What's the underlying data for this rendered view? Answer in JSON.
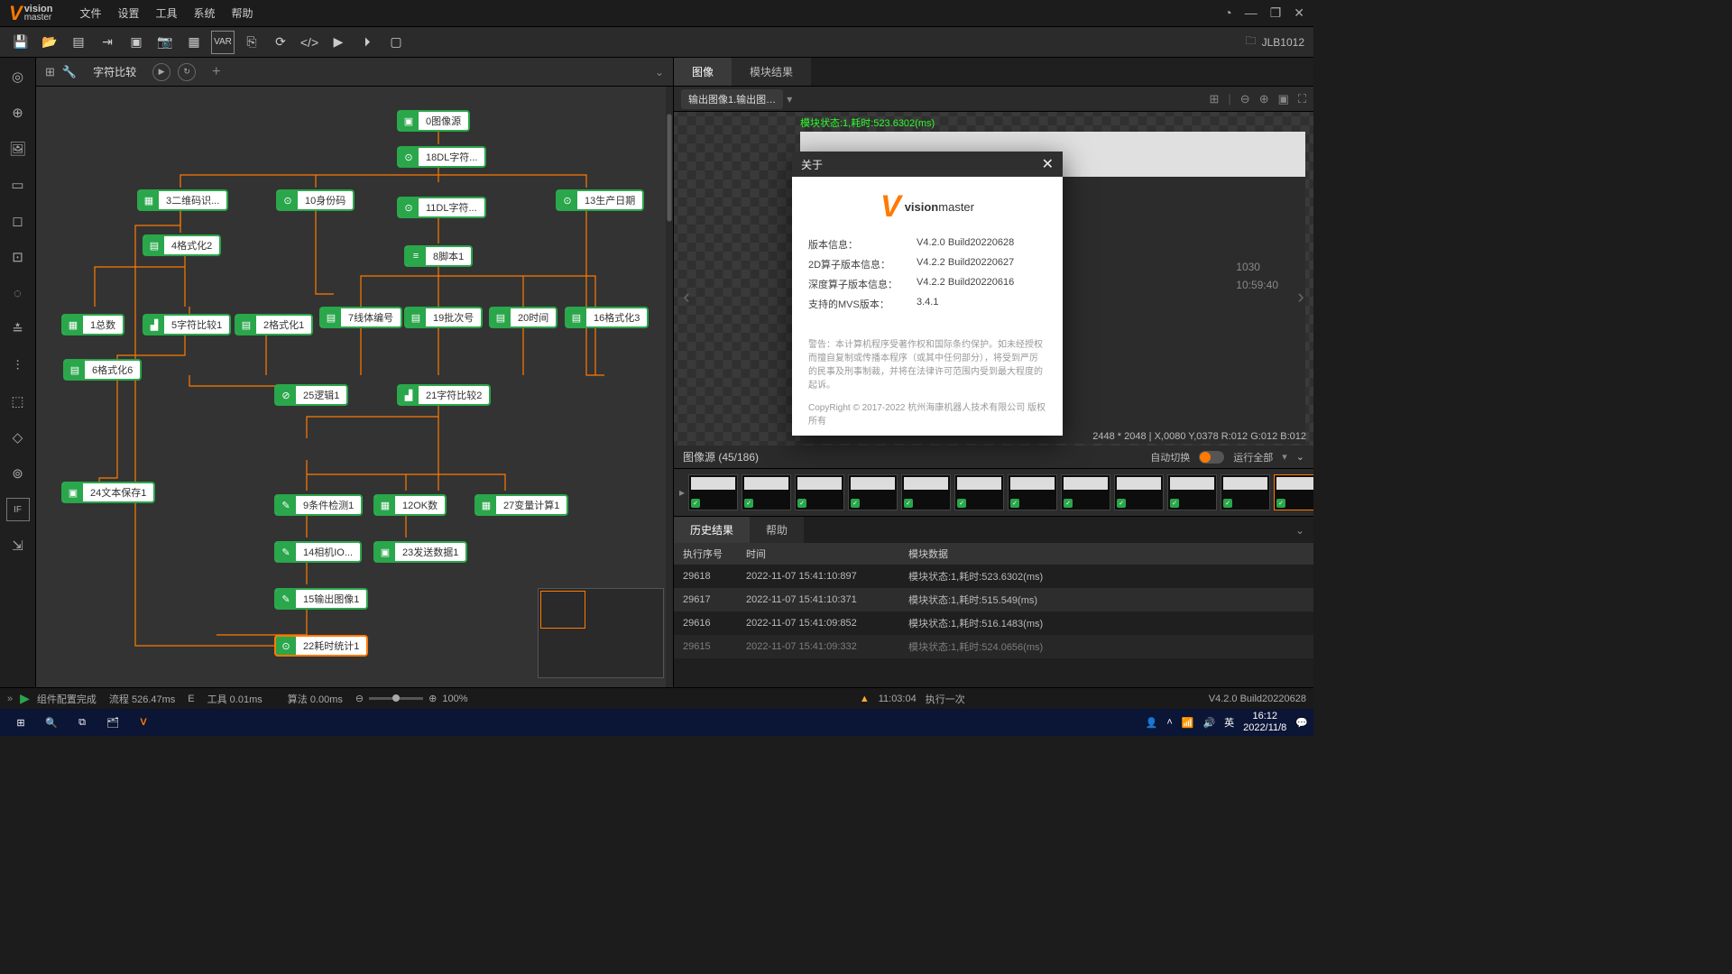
{
  "menu": {
    "items": [
      "文件",
      "设置",
      "工具",
      "系统",
      "帮助"
    ]
  },
  "window_controls": {
    "help": "?",
    "min": "—",
    "max": "❐",
    "close": "✕"
  },
  "project_label": "JLB1012",
  "canvas_tab": "字符比较",
  "toolbar_icons": [
    "save-icon",
    "open-icon",
    "new-icon",
    "import-icon",
    "image-icon",
    "camera-icon",
    "grid-icon",
    "var-icon",
    "brackets-icon",
    "refresh-icon",
    "code-icon",
    "play-icon",
    "play-once-icon",
    "form-icon"
  ],
  "left_icons": [
    "camera-tool-icon",
    "target-icon",
    "image-tool-icon",
    "align-icon",
    "select-icon",
    "dotted-box-icon",
    "gear-ring-icon",
    "tune-icon",
    "chart-icon",
    "layers-icon",
    "paint-icon",
    "scope-icon",
    "if-icon",
    "export-icon"
  ],
  "nodes": {
    "n0": "0图像源",
    "n18": "18DL字符...",
    "n3": "3二维码识...",
    "n10": "10身份码",
    "n11": "11DL字符...",
    "n13": "13生产日期",
    "n4": "4格式化2",
    "n8": "8脚本1",
    "n1": "1总数",
    "n5": "5字符比较1",
    "n2": "2格式化1",
    "n7": "7线体编号",
    "n19": "19批次号",
    "n20": "20时间",
    "n16": "16格式化3",
    "n6": "6格式化6",
    "n25": "25逻辑1",
    "n21": "21字符比较2",
    "n24": "24文本保存1",
    "n9": "9条件检测1",
    "n12": "12OK数",
    "n27": "27变量计算1",
    "n14": "14相机IO...",
    "n23": "23发送数据1",
    "n15": "15输出图像1",
    "n22": "22耗时统计1"
  },
  "right": {
    "tabs": [
      "图像",
      "模块结果"
    ],
    "output_chip": "输出图像1.输出图…",
    "status_text": "模块状态:1,耗时:523.6302(ms)",
    "stamp": {
      "l1": "1030",
      "l2": "10:59:40"
    },
    "coords": "2448 * 2048   |  X,0080  Y,0378   R:012  G:012  B:012",
    "thumbs_title": "图像源 (45/186)",
    "thumbs_auto": "自动切换",
    "thumbs_run": "运行全部",
    "bottom_tabs": [
      "历史结果",
      "帮助"
    ],
    "th": [
      "执行序号",
      "时间",
      "模块数据"
    ],
    "rows": [
      {
        "seq": "29618",
        "t": "2022-11-07 15:41:10:897",
        "d": "模块状态:1,耗时:523.6302(ms)"
      },
      {
        "seq": "29617",
        "t": "2022-11-07 15:41:10:371",
        "d": "模块状态:1,耗时:515.549(ms)"
      },
      {
        "seq": "29616",
        "t": "2022-11-07 15:41:09:852",
        "d": "模块状态:1,耗时:516.1483(ms)"
      },
      {
        "seq": "29615",
        "t": "2022-11-07 15:41:09:332",
        "d": "模块状态:1,耗时:524.0656(ms)"
      }
    ]
  },
  "status": {
    "ready": "组件配置完成",
    "flow": "流程  526.47ms",
    "e": "E",
    "tool": "工具   0.01ms",
    "alg": "算法  0.00ms",
    "zoom": "100%",
    "time": "11:03:04",
    "run_once": "执行一次",
    "version": "V4.2.0 Build20220628"
  },
  "taskbar": {
    "time": "16:12",
    "date": "2022/11/8",
    "lang": "英"
  },
  "about": {
    "title": "关于",
    "brand_top": "vision",
    "brand_bottom": "master",
    "rows": [
      {
        "k": "版本信息：",
        "v": "V4.2.0 Build20220628"
      },
      {
        "k": "2D算子版本信息：",
        "v": "V4.2.2 Build20220627"
      },
      {
        "k": "深度算子版本信息：",
        "v": "V4.2.2 Build20220616"
      },
      {
        "k": "支持的MVS版本：",
        "v": "3.4.1"
      }
    ],
    "disclaimer": "警告：本计算机程序受著作权和国际条约保护。如未经授权而擅自复制或传播本程序（或其中任何部分），将受到严厉的民事及刑事制裁，并将在法律许可范围内受到最大程度的起诉。",
    "copyright": "CopyRight © 2017-2022 杭州海康机器人技术有限公司 版权所有"
  }
}
